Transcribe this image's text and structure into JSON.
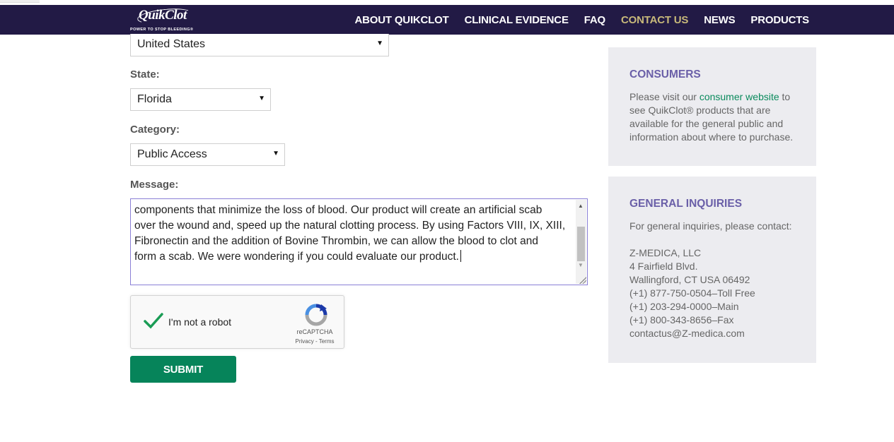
{
  "brand": {
    "logo_text": "QuikClot",
    "tagline": "POWER TO STOP BLEEDING®"
  },
  "nav": {
    "items": [
      {
        "label": "ABOUT QUIKCLOT",
        "active": false
      },
      {
        "label": "CLINICAL EVIDENCE",
        "active": false
      },
      {
        "label": "FAQ",
        "active": false
      },
      {
        "label": "CONTACT US",
        "active": true
      },
      {
        "label": "NEWS",
        "active": false
      },
      {
        "label": "PRODUCTS",
        "active": false
      }
    ],
    "active_color": "#c8b97a",
    "bar_color": "#221a45"
  },
  "form": {
    "country": {
      "selected": "United States"
    },
    "state": {
      "label": "State:",
      "selected": "Florida"
    },
    "category": {
      "label": "Category:",
      "selected": "Public Access"
    },
    "message": {
      "label": "Message:",
      "value": "components that minimize the loss of blood. Our product will create an artificial scab\nover the wound and, speed up the natural clotting process. By using Factors VIII, IX, XIII,\nFibronectin and the addition of Bovine Thrombin, we can allow the blood to clot and\nform a scab. We were wondering if you could evaluate our product."
    },
    "captcha": {
      "label": "I'm not a robot",
      "brand": "reCAPTCHA",
      "links": "Privacy - Terms"
    },
    "submit_label": "SUBMIT"
  },
  "sidebar": {
    "consumers": {
      "title": "CONSUMERS",
      "text_before": "Please visit our ",
      "link": "consumer website",
      "text_after": " to see QuikClot® products that are available for the general public and information about where to purchase."
    },
    "general": {
      "title": "GENERAL INQUIRIES",
      "intro": "For general inquiries, please contact:",
      "lines": [
        "Z-MEDICA, LLC",
        "4 Fairfield Blvd.",
        "Wallingford, CT USA 06492",
        "(+1) 877-750-0504–Toll Free",
        "(+1) 203-294-0000–Main",
        "(+1) 800-343-8656–Fax",
        "contactus@Z-medica.com"
      ]
    }
  }
}
